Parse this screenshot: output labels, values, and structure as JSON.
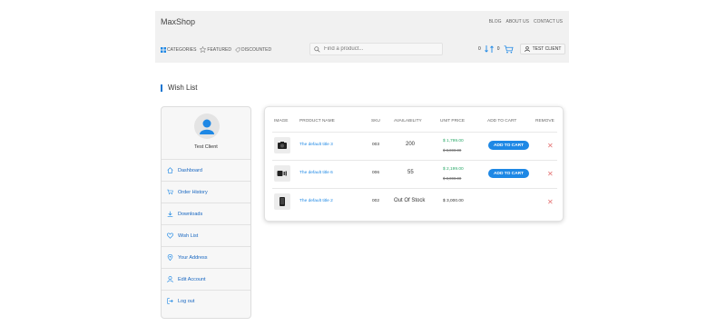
{
  "header": {
    "logo": "MaxShop",
    "top_links": [
      "BLOG",
      "ABOUT US",
      "CONTACT US"
    ],
    "nav": [
      "CATEGORIES",
      "FEATURED",
      "DISCOUNTED"
    ],
    "search_placeholder": "Find a product...",
    "compare_count": "0",
    "cart_count": "0",
    "client_label": "TEST CLIENT"
  },
  "page_title": "Wish List",
  "sidebar": {
    "username": "Test Client",
    "items": [
      "Dashboard",
      "Order History",
      "Downloads",
      "Wish List",
      "Your Address",
      "Edit Account",
      "Log out"
    ]
  },
  "wishlist": {
    "headers": [
      "IMAGE",
      "PRODUCT NAME",
      "SKU",
      "AVAILABILITY",
      "UNIT PRICE",
      "ADD TO CART",
      "REMOVE"
    ],
    "rows": [
      {
        "name": "The default title 3",
        "sku": "003",
        "availability": "200",
        "price": "$ 1,799.00",
        "old_price": "$ 3,000.00",
        "add_label": "ADD TO CART"
      },
      {
        "name": "The default title 6",
        "sku": "006",
        "availability": "55",
        "price": "$ 2,199.00",
        "old_price": "$ 3,000.00",
        "add_label": "ADD TO CART"
      },
      {
        "name": "The default title 2",
        "sku": "002",
        "availability": "Out Of Stock",
        "price": "$ 3,000.00",
        "old_price": null,
        "add_label": null
      }
    ],
    "remove_symbol": "✕"
  },
  "colors": {
    "accent": "#1e88e5",
    "sale": "#2aa868",
    "remove": "#e57373"
  }
}
